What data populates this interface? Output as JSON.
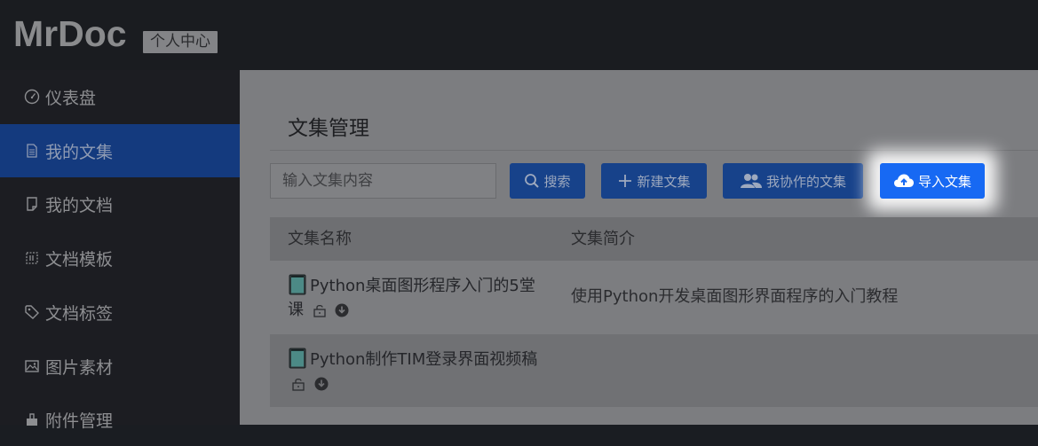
{
  "header": {
    "logo": "MrDoc",
    "badge": "个人中心"
  },
  "sidebar": {
    "items": [
      {
        "label": "仪表盘",
        "icon": "dashboard-icon",
        "active": false
      },
      {
        "label": "我的文集",
        "icon": "document-icon",
        "active": true
      },
      {
        "label": "我的文档",
        "icon": "file-icon",
        "active": false
      },
      {
        "label": "文档模板",
        "icon": "template-icon",
        "active": false
      },
      {
        "label": "文档标签",
        "icon": "tag-icon",
        "active": false
      },
      {
        "label": "图片素材",
        "icon": "image-icon",
        "active": false
      },
      {
        "label": "附件管理",
        "icon": "attachment-icon",
        "active": false
      }
    ]
  },
  "main": {
    "title": "文集管理",
    "search": {
      "placeholder": "输入文集内容",
      "value": ""
    },
    "buttons": {
      "search": "搜索",
      "new": "新建文集",
      "collab": "我协作的文集",
      "import": "导入文集"
    },
    "table": {
      "columns": [
        "文集名称",
        "文集简介"
      ],
      "rows": [
        {
          "name": "Python桌面图形程序入门的5堂课",
          "desc": "使用Python开发桌面图形界面程序的入门教程"
        },
        {
          "name": "Python制作TIM登录界面视频稿",
          "desc": ""
        }
      ]
    }
  },
  "colors": {
    "sidebar_active": "#143a7e",
    "button": "#17428a",
    "import_button": "#1769f3"
  }
}
